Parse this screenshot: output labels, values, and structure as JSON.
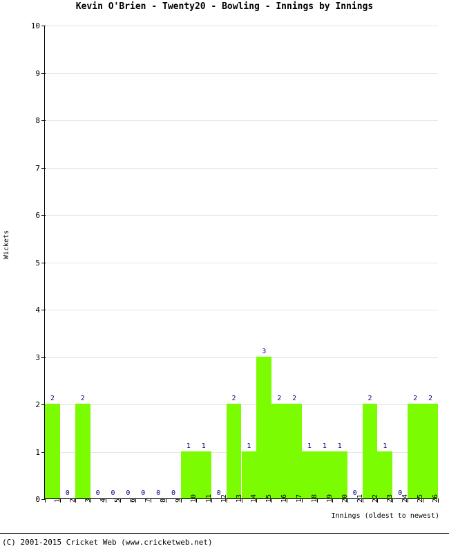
{
  "chart_data": {
    "type": "bar",
    "title": "Kevin O'Brien - Twenty20 - Bowling - Innings by Innings",
    "xlabel": "Innings (oldest to newest)",
    "ylabel": "Wickets",
    "ylim": [
      0,
      10
    ],
    "ytick_labels": [
      "10",
      "9",
      "8",
      "7",
      "6",
      "5",
      "4",
      "3",
      "2",
      "1",
      "0"
    ],
    "yticks": [
      10,
      9,
      8,
      7,
      6,
      5,
      4,
      3,
      2,
      1,
      0
    ],
    "grid": true,
    "legend": null,
    "bar_color": "#7CFC00",
    "value_label_color": "#000080",
    "categories": [
      "1",
      "2",
      "3",
      "4",
      "5",
      "6",
      "7",
      "8",
      "9",
      "10",
      "11",
      "12",
      "13",
      "14",
      "15",
      "16",
      "17",
      "18",
      "19",
      "20",
      "21",
      "22",
      "23",
      "24",
      "25",
      "26"
    ],
    "values": [
      2,
      0,
      2,
      0,
      0,
      0,
      0,
      0,
      0,
      1,
      1,
      0,
      2,
      1,
      3,
      2,
      2,
      1,
      1,
      1,
      0,
      2,
      1,
      0,
      2,
      2
    ],
    "data_labels": [
      "2",
      "0",
      "2",
      "0",
      "0",
      "0",
      "0",
      "0",
      "0",
      "1",
      "1",
      "0",
      "2",
      "1",
      "3",
      "2",
      "2",
      "1",
      "1",
      "1",
      "0",
      "2",
      "1",
      "0",
      "2",
      "2"
    ]
  },
  "footer": {
    "copyright": "(C) 2001-2015 Cricket Web (www.cricketweb.net)"
  }
}
